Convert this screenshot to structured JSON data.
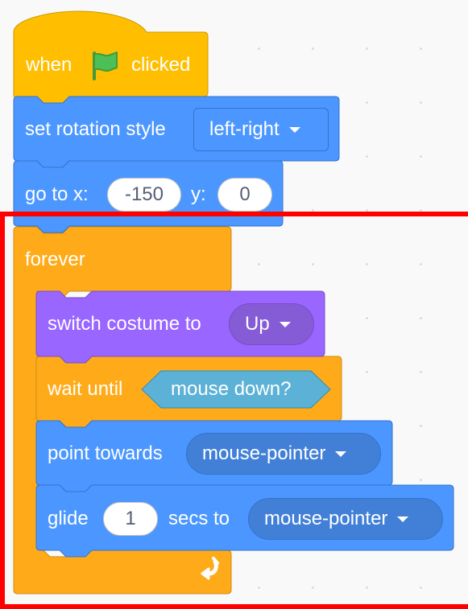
{
  "blocks": {
    "hat": {
      "when": "when",
      "clicked": "clicked",
      "icon": "green-flag-icon"
    },
    "set_rotation": {
      "label": "set rotation style",
      "value": "left-right"
    },
    "go_to": {
      "label_x": "go to x:",
      "x": "-150",
      "label_y": "y:",
      "y": "0"
    },
    "forever": {
      "label": "forever",
      "loop_icon": "loop-arrow-icon"
    },
    "switch_costume": {
      "label": "switch costume to",
      "value": "Up"
    },
    "wait_until": {
      "label": "wait until",
      "condition": "mouse down?"
    },
    "point_towards": {
      "label": "point towards",
      "value": "mouse-pointer"
    },
    "glide": {
      "label": "glide",
      "secs": "1",
      "label2": "secs to",
      "target": "mouse-pointer"
    }
  },
  "colors": {
    "events": "#FFBF00",
    "motion": "#4C97FF",
    "looks": "#9966FF",
    "control": "#FFAB19",
    "sensing": "#5CB1D6",
    "highlight": "#FF0000"
  }
}
